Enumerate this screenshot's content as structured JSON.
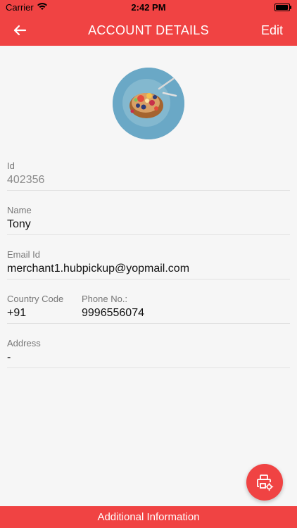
{
  "status_bar": {
    "carrier": "Carrier",
    "time": "2:42 PM"
  },
  "nav": {
    "title": "ACCOUNT DETAILS",
    "edit_label": "Edit"
  },
  "profile": {
    "avatar_icon": "profile-photo-food"
  },
  "fields": {
    "id": {
      "label": "Id",
      "value": "402356"
    },
    "name": {
      "label": "Name",
      "value": "Tony"
    },
    "email": {
      "label": "Email Id",
      "value": "merchant1.hubpickup@yopmail.com"
    },
    "country_code": {
      "label": "Country Code",
      "value": "+91"
    },
    "phone": {
      "label": "Phone No.:",
      "value": "9996556074"
    },
    "address": {
      "label": "Address",
      "value": "-"
    }
  },
  "fab": {
    "icon": "printer-settings-icon"
  },
  "bottom_bar": {
    "label": "Additional Information"
  },
  "colors": {
    "accent": "#f04343",
    "background": "#f6f6f6"
  }
}
